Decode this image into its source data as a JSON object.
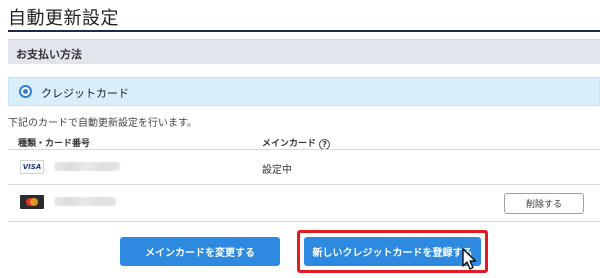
{
  "page": {
    "title": "自動更新設定"
  },
  "payment_section": {
    "header": "お支払い方法",
    "method_label": "クレジットカード",
    "method_selected": true,
    "description": "下記のカードで自動更新設定を行います。"
  },
  "cards_table": {
    "columns": [
      "種類・カード番号",
      "メインカード"
    ],
    "help_icon_label": "?",
    "rows": [
      {
        "brand": "VISA",
        "brand_icon": "visa-logo",
        "number_masked": true,
        "status": "設定中",
        "action": ""
      },
      {
        "brand": "Mastercard",
        "brand_icon": "mastercard-logo",
        "number_masked": true,
        "status": "",
        "action": "削除する"
      }
    ]
  },
  "actions": {
    "change_main_card": "メインカードを変更する",
    "register_new_card": "新しいクレジットカードを登録する"
  },
  "colors": {
    "accent_blue": "#2e8ae0",
    "highlight_red": "#e21b23",
    "method_bar_bg": "#d8eefb",
    "section_header_bg": "#e2e5ec"
  }
}
